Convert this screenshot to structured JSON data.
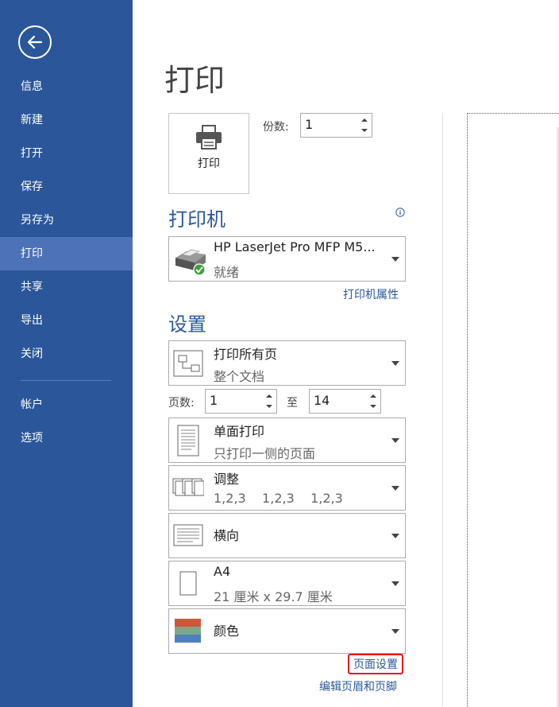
{
  "sidebar": {
    "items": [
      {
        "label": "信息",
        "active": false
      },
      {
        "label": "新建",
        "active": false
      },
      {
        "label": "打开",
        "active": false
      },
      {
        "label": "保存",
        "active": false
      },
      {
        "label": "另存为",
        "active": false
      },
      {
        "label": "打印",
        "active": true
      },
      {
        "label": "共享",
        "active": false
      },
      {
        "label": "导出",
        "active": false
      },
      {
        "label": "关闭",
        "active": false
      }
    ],
    "bottom_items": [
      {
        "label": "帐户"
      },
      {
        "label": "选项"
      }
    ]
  },
  "page_title": "打印",
  "print_button_label": "打印",
  "copies": {
    "label": "份数:",
    "value": "1"
  },
  "printer": {
    "section_title": "打印机",
    "name": "HP LaserJet Pro MFP M5...",
    "status": "就绪",
    "properties_link": "打印机属性"
  },
  "settings": {
    "section_title": "设置",
    "print_range": {
      "main": "打印所有页",
      "sub": "整个文档"
    },
    "pages": {
      "label": "页数:",
      "from": "1",
      "to_label": "至",
      "to": "14"
    },
    "sides": {
      "main": "单面打印",
      "sub": "只打印一侧的页面"
    },
    "collate": {
      "main": "调整",
      "sub": "1,2,3    1,2,3    1,2,3"
    },
    "orientation": {
      "main": "横向"
    },
    "paper": {
      "main": "A4",
      "sub": "21 厘米 x 29.7 厘米"
    },
    "color": {
      "main": "颜色"
    },
    "page_setup_link": "页面设置",
    "header_footer_link": "编辑页眉和页脚"
  },
  "colors": {
    "sidebar_bg": "#2b579a",
    "sidebar_active": "#4d72b8",
    "accent": "#2b579a",
    "highlight_border": "#e81123"
  },
  "icons": [
    "back-arrow-icon",
    "printer-icon",
    "info-icon",
    "printer-device-icon",
    "print-range-icon",
    "single-sided-icon",
    "collate-icon",
    "landscape-icon",
    "paper-size-icon",
    "color-swatch-icon",
    "chevron-down-icon",
    "spin-up-icon",
    "spin-down-icon"
  ]
}
